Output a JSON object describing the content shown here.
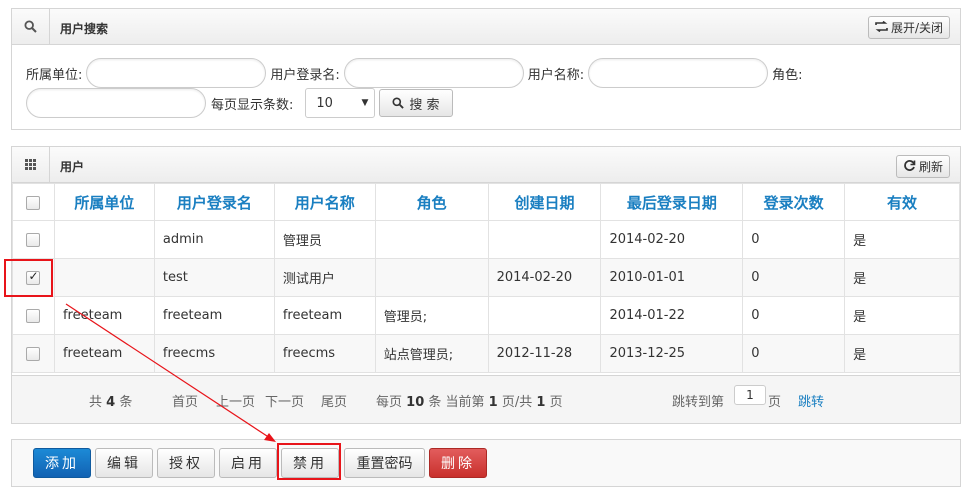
{
  "search_panel": {
    "title": "用户搜索",
    "toggle_label": "展开/关闭",
    "fields": {
      "unit_label": "所属单位:",
      "login_label": "用户登录名:",
      "name_label": "用户名称:",
      "role_label": "角色:",
      "page_size_label": "每页显示条数:",
      "page_size_value": "10"
    },
    "search_button": "搜 索"
  },
  "user_panel": {
    "title": "用户",
    "refresh_label": "刷新",
    "columns": [
      "所属单位",
      "用户登录名",
      "用户名称",
      "角色",
      "创建日期",
      "最后登录日期",
      "登录次数",
      "有效"
    ],
    "rows": [
      {
        "checked": false,
        "unit": "",
        "login": "admin",
        "name": "管理员",
        "role": "",
        "created": "",
        "last_login": "2014-02-20",
        "count": "0",
        "valid": "是"
      },
      {
        "checked": true,
        "unit": "",
        "login": "test",
        "name": "测试用户",
        "role": "",
        "created": "2014-02-20",
        "last_login": "2010-01-01",
        "count": "0",
        "valid": "是"
      },
      {
        "checked": false,
        "unit": "freeteam",
        "login": "freeteam",
        "name": "freeteam",
        "role": "管理员;",
        "created": "",
        "last_login": "2014-01-22",
        "count": "0",
        "valid": "是"
      },
      {
        "checked": false,
        "unit": "freeteam",
        "login": "freecms",
        "name": "freecms",
        "role": "站点管理员;",
        "created": "2012-11-28",
        "last_login": "2013-12-25",
        "count": "0",
        "valid": "是"
      }
    ]
  },
  "pager": {
    "total_prefix": "共",
    "total": "4",
    "total_suffix": "条",
    "first": "首页",
    "prev": "上一页",
    "next": "下一页",
    "last": "尾页",
    "per_page_prefix": "每页",
    "per_page": "10",
    "per_page_mid": "条 当前第",
    "current": "1",
    "of": "页/共",
    "pages": "1",
    "pages_suffix": "页",
    "jump_prefix": "跳转到第",
    "jump_value": "1",
    "jump_suffix": "页",
    "jump_button": "跳转"
  },
  "actions": {
    "add": "添加",
    "edit": "编辑",
    "authorize": "授权",
    "enable": "启用",
    "disable": "禁用",
    "reset_password": "重置密码",
    "delete": "删除"
  },
  "colors": {
    "header_text": "#1a7fc1",
    "primary": "#1771c6",
    "danger": "#d9534f",
    "annotation": "#e8141a"
  }
}
